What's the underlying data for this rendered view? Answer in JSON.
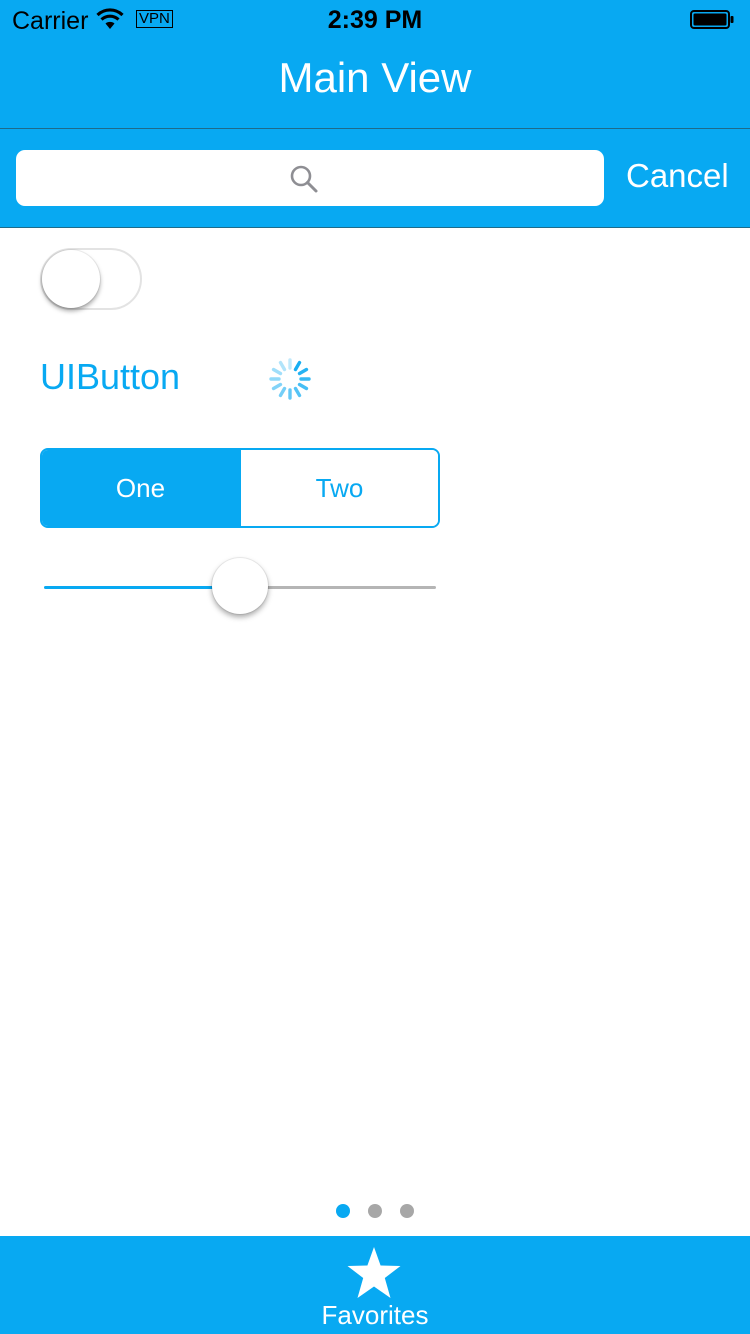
{
  "status_bar": {
    "carrier": "Carrier",
    "vpn": "VPN",
    "time": "2:39 PM"
  },
  "nav_bar": {
    "title": "Main View"
  },
  "search": {
    "placeholder": "",
    "cancel_label": "Cancel"
  },
  "controls": {
    "switch_on": false,
    "button_label": "UIButton",
    "segments": [
      {
        "label": "One",
        "selected": true
      },
      {
        "label": "Two",
        "selected": false
      }
    ],
    "slider_value": 0.5
  },
  "page_control": {
    "pages": 3,
    "current": 1
  },
  "tab_bar": {
    "items": [
      {
        "label": "Favorites",
        "icon": "star-icon"
      }
    ]
  },
  "colors": {
    "accent": "#08a9f2",
    "track_inactive": "#b5b5b5",
    "dot_inactive": "#a7a7a7"
  }
}
